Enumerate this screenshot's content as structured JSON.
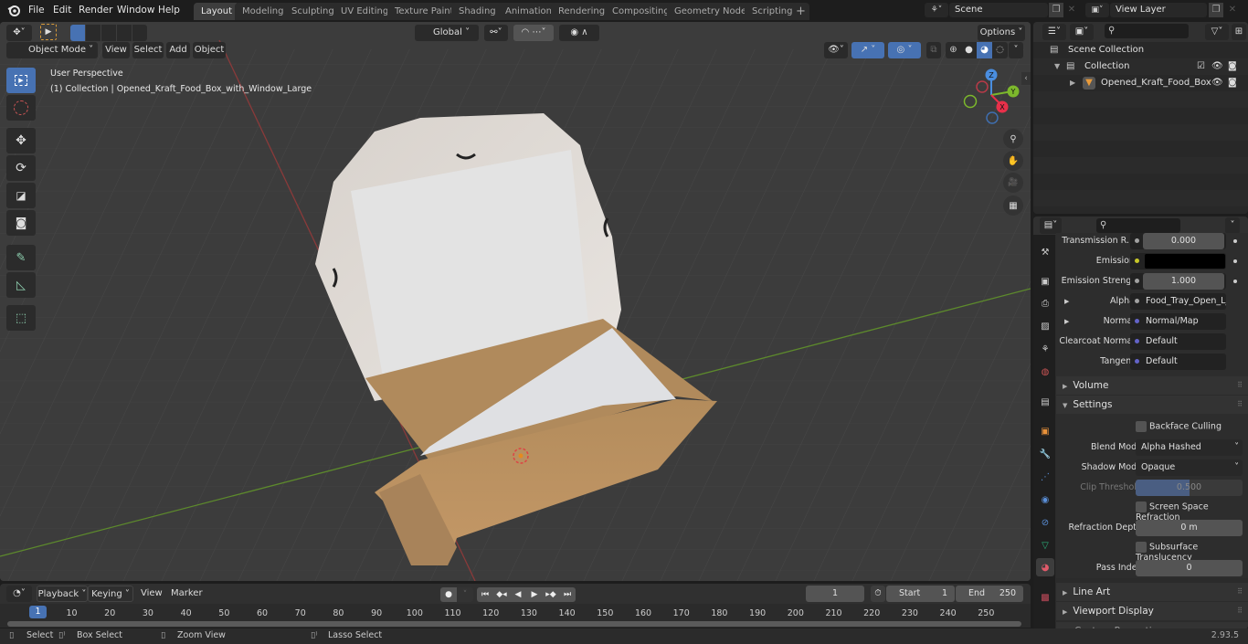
{
  "menus": [
    "File",
    "Edit",
    "Render",
    "Window",
    "Help"
  ],
  "workspace_tabs": [
    "Layout",
    "Modeling",
    "Sculpting",
    "UV Editing",
    "Texture Paint",
    "Shading",
    "Animation",
    "Rendering",
    "Compositing",
    "Geometry Nodes",
    "Scripting"
  ],
  "active_workspace": "Layout",
  "scene": {
    "name": "Scene",
    "view_layer": "View Layer"
  },
  "viewport": {
    "mode": "Object Mode",
    "menus": [
      "View",
      "Select",
      "Add",
      "Object"
    ],
    "transform_orientation": "Global",
    "options_label": "Options",
    "view_name": "User Perspective",
    "collection_info": "(1) Collection | Opened_Kraft_Food_Box_with_Window_Large",
    "gizmo_axes": {
      "x": "X",
      "y": "Y",
      "z": "Z"
    }
  },
  "outliner": {
    "rows": [
      {
        "label": "Scene Collection",
        "icon": "collection-icon"
      },
      {
        "label": "Collection",
        "icon": "collection-icon"
      },
      {
        "label": "Opened_Kraft_Food_Box",
        "icon": "mesh-object-icon"
      }
    ]
  },
  "properties": {
    "fields": [
      {
        "label": "Transmission R...",
        "value": "0.000",
        "kind": "number",
        "socket": "#a1a1a1"
      },
      {
        "label": "Emission",
        "value": "",
        "kind": "color",
        "socket": "#c7c729",
        "color": "#000000"
      },
      {
        "label": "Emission Strengt",
        "value": "1.000",
        "kind": "number",
        "socket": "#a1a1a1"
      },
      {
        "label": "Alpha",
        "value": "Food_Tray_Open_L_...",
        "kind": "link",
        "socket": "#a1a1a1"
      },
      {
        "label": "Normal",
        "value": "Normal/Map",
        "kind": "link",
        "socket": "#6363c7"
      },
      {
        "label": "Clearcoat Normal",
        "value": "Default",
        "kind": "link",
        "socket": "#6363c7"
      },
      {
        "label": "Tangent",
        "value": "Default",
        "kind": "link",
        "socket": "#6363c7"
      }
    ],
    "sections": {
      "volume": "Volume",
      "settings": "Settings",
      "line_art": "Line Art",
      "viewport_display": "Viewport Display",
      "custom_props": "Custom Properties"
    },
    "settings": {
      "backface_culling": "Backface Culling",
      "blend_mode_label": "Blend Mode",
      "blend_mode": "Alpha Hashed",
      "shadow_mode_label": "Shadow Mode",
      "shadow_mode": "Opaque",
      "clip_threshold_label": "Clip Threshold",
      "clip_threshold": "0.500",
      "clip_threshold_fraction": 0.5,
      "ssr": "Screen Space Refraction",
      "refraction_depth_label": "Refraction Depth",
      "refraction_depth": "0 m",
      "subsurface": "Subsurface Translucency",
      "pass_index_label": "Pass Index",
      "pass_index": "0"
    }
  },
  "timeline": {
    "menus": [
      "Playback",
      "Keying",
      "View",
      "Marker"
    ],
    "current_frame": "1",
    "start_label": "Start",
    "start": "1",
    "end_label": "End",
    "end": "250",
    "ticks": [
      "10",
      "20",
      "30",
      "40",
      "50",
      "60",
      "70",
      "80",
      "90",
      "100",
      "110",
      "120",
      "130",
      "140",
      "150",
      "160",
      "170",
      "180",
      "190",
      "200",
      "210",
      "220",
      "230",
      "240",
      "250"
    ]
  },
  "statusbar": {
    "select": "Select",
    "box_select": "Box Select",
    "zoom_view": "Zoom View",
    "lasso_select": "Lasso Select",
    "version": "2.93.5"
  }
}
